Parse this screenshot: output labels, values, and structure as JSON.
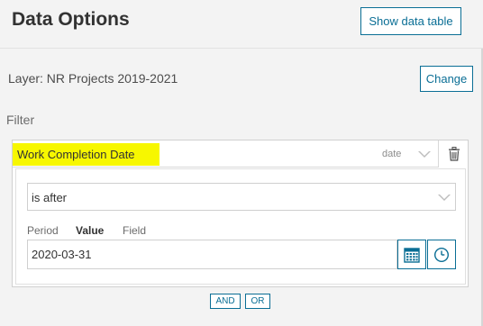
{
  "header": {
    "title": "Data Options",
    "show_table_label": "Show data table"
  },
  "layer": {
    "label": "Layer: NR Projects 2019-2021",
    "change_label": "Change"
  },
  "filter": {
    "section_label": "Filter",
    "field_name": "Work Completion Date",
    "field_type": "date",
    "operator": "is after",
    "mode_tabs": [
      {
        "label": "Period",
        "active": false
      },
      {
        "label": "Value",
        "active": true
      },
      {
        "label": "Field",
        "active": false
      }
    ],
    "value": "2020-03-31",
    "and_label": "AND",
    "or_label": "OR"
  },
  "icons": {
    "trash": "trash-icon",
    "calendar": "calendar-icon",
    "clock": "clock-icon",
    "dropdown": "chevron-down-icon"
  },
  "colors": {
    "accent": "#0a6e95",
    "highlight": "#f7f700",
    "background": "#f3f3f3"
  }
}
